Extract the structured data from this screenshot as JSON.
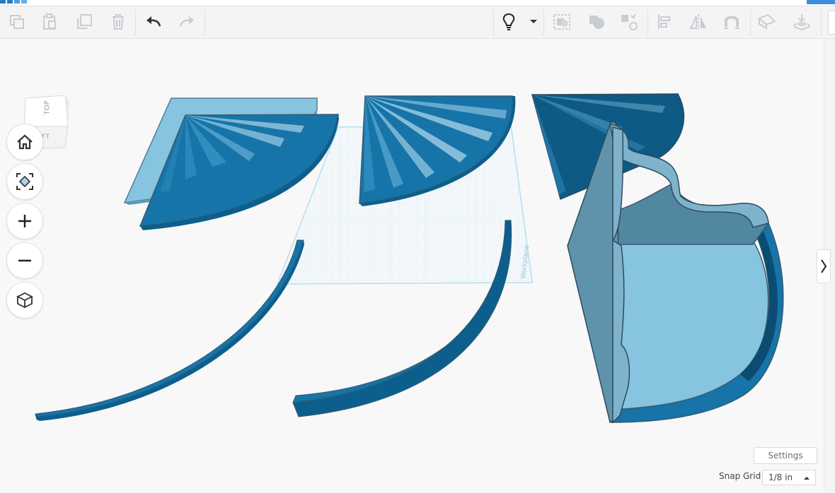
{
  "toolbar": {
    "left_tools": [
      "copy-icon",
      "paste-icon",
      "duplicate-icon",
      "delete-icon"
    ],
    "history_tools": [
      "undo-icon",
      "redo-icon"
    ],
    "right_tools": [
      "lightbulb-icon",
      "chevron-down-icon",
      "group-icon",
      "ungroup-icon",
      "hole-solid-icon",
      "align-icon",
      "mirror-icon",
      "magnet-icon",
      "cruise-icon",
      "drop-icon"
    ]
  },
  "viewcube": {
    "top_label": "TOP",
    "left_label": "LEFT"
  },
  "nav": {
    "buttons": [
      "home-view-icon",
      "fit-all-icon",
      "zoom-in-icon",
      "zoom-out-icon",
      "ortho-view-icon"
    ]
  },
  "workplane": {
    "label": "Workplane"
  },
  "settings": {
    "label": "Settings"
  },
  "snap_grid": {
    "label": "Snap Grid",
    "value": "1/8 in"
  },
  "colors": {
    "part_dark": "#0f6ea2",
    "part_light": "#86c4df",
    "grid_line": "#9fd2ea"
  }
}
